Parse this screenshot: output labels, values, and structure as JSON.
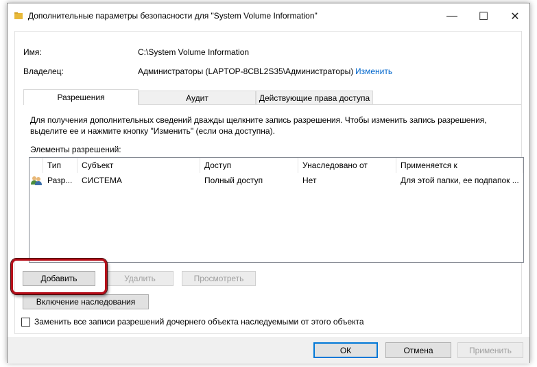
{
  "window": {
    "title": "Дополнительные параметры безопасности  для \"System Volume Information\"",
    "minimize_glyph": "—",
    "maximize_glyph": "☐",
    "close_glyph": "✕"
  },
  "fields": {
    "name_label": "Имя:",
    "name_value": "C:\\System Volume Information",
    "owner_label": "Владелец:",
    "owner_value": "Администраторы (LAPTOP-8CBL2S35\\Администраторы)",
    "owner_change_link": "Изменить"
  },
  "tabs": [
    {
      "label": "Разрешения",
      "active": true
    },
    {
      "label": "Аудит",
      "active": false
    },
    {
      "label": "Действующие права доступа",
      "active": false
    }
  ],
  "permissions_panel": {
    "info_text": "Для получения дополнительных сведений дважды щелкните запись разрешения. Чтобы изменить запись разрешения, выделите ее и нажмите кнопку \"Изменить\" (если она доступна).",
    "list_title": "Элементы разрешений:",
    "columns": [
      "Тип",
      "Субъект",
      "Доступ",
      "Унаследовано от",
      "Применяется к"
    ],
    "rows": [
      {
        "icon": "users-group-icon",
        "type": "Разр...",
        "subject": "СИСТЕМА",
        "access": "Полный доступ",
        "inherited_from": "Нет",
        "applies_to": "Для этой папки, ее подпапок ..."
      }
    ],
    "add_button": "Добавить",
    "remove_button": "Удалить",
    "view_button": "Просмотреть",
    "inheritance_button": "Включение наследования",
    "replace_checkbox_label": "Заменить все записи разрешений дочернего объекта наследуемыми от этого объекта",
    "replace_checked": false
  },
  "footer": {
    "ok_button": "ОК",
    "cancel_button": "Отмена",
    "apply_button": "Применить"
  },
  "colors": {
    "link": "#0066cc",
    "highlight": "#b40c18",
    "default_button_border": "#0078d7"
  }
}
